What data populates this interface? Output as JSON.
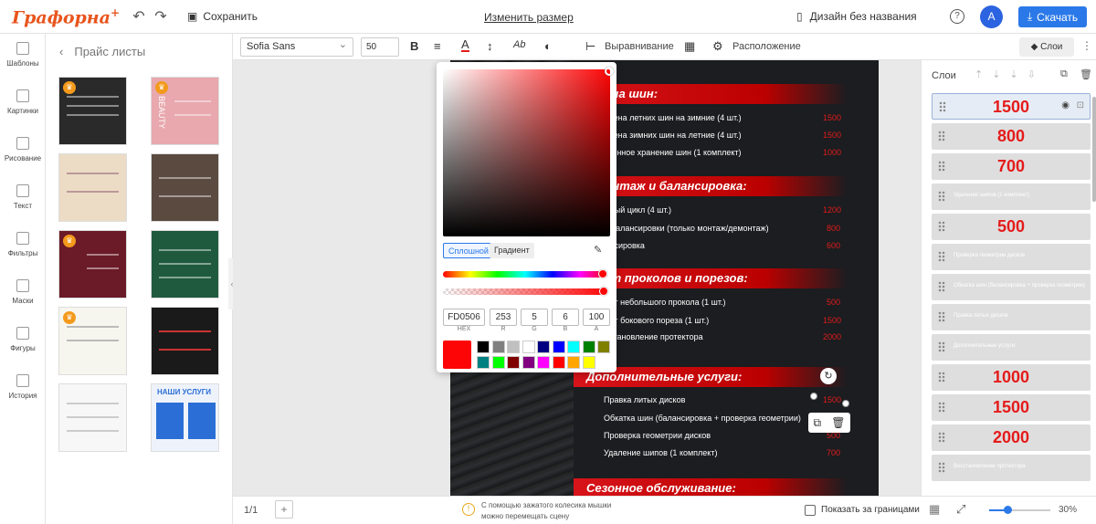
{
  "app": {
    "logo": "Графорна",
    "logo_plus": "+"
  },
  "topbar": {
    "save_label": "Сохранить",
    "resize_label": "Изменить размер",
    "doc_name": "Дизайн без названия",
    "help": "?",
    "avatar": "A",
    "download_label": "Скачать"
  },
  "leftnav": [
    {
      "label": "Шаблоны",
      "icon": "templates-icon"
    },
    {
      "label": "Картинки",
      "icon": "images-icon"
    },
    {
      "label": "Рисование",
      "icon": "draw-icon"
    },
    {
      "label": "Текст",
      "icon": "text-icon"
    },
    {
      "label": "Фильтры",
      "icon": "filters-icon"
    },
    {
      "label": "Маски",
      "icon": "masks-icon"
    },
    {
      "label": "Фигуры",
      "icon": "shapes-icon"
    },
    {
      "label": "История",
      "icon": "history-icon"
    }
  ],
  "panel": {
    "title": "Прайс листы",
    "thumb_text_1": "BEAUTY",
    "thumb_text_2": "НАШИ УСЛУГИ"
  },
  "toolbar": {
    "font": "Sofia Sans",
    "size": "50",
    "bold": "B",
    "align_label": "Выравнивание",
    "position_label": "Расположение",
    "layers_button": "Слои"
  },
  "color_picker": {
    "tab_solid": "Сплошной",
    "tab_gradient": "Градиент",
    "hex": "FD0506",
    "r": "253",
    "g": "5",
    "b": "6",
    "a": "100",
    "hex_label": "HEX",
    "r_label": "R",
    "g_label": "G",
    "b_label": "B",
    "a_label": "A",
    "current_color": "#fd0506",
    "hue": 0.995,
    "alpha": 1.0,
    "swatches": [
      "#000000",
      "#808080",
      "#c0c0c0",
      "#ffffff",
      "#000080",
      "#0000ff",
      "#00ffff",
      "#008000",
      "#808000",
      "#008080",
      "#00ff00",
      "#800000",
      "#800080",
      "#ff00ff",
      "#ff0000",
      "#ffa500",
      "#ffff00"
    ]
  },
  "poster": {
    "sections": [
      {
        "title": "Замена шин:",
        "shown": "...мена шин:",
        "rows": [
          [
            "Замена летних шин на зимние (4 шт.)",
            "1500"
          ],
          [
            "Замена зимних шин на летние (4 шт.)",
            "1500"
          ],
          [
            "Сезонное хранение шин (1 комплект)",
            "1000"
          ]
        ]
      },
      {
        "title": "...монтаж и балансировка:",
        "rows": [
          [
            "...лный цикл (4 шт.)",
            "1200"
          ],
          [
            "...з балансировки (только монтаж/демонтаж)",
            "800"
          ],
          [
            "...ансировка",
            "600"
          ]
        ]
      },
      {
        "title": "...онт проколов и порезов:",
        "rows": [
          [
            "...онт небольшого прокола (1 шт.)",
            "500"
          ],
          [
            "...онт бокового пореза (1 шт.)",
            "1500"
          ],
          [
            "...сстановление протектора",
            "2000"
          ]
        ]
      },
      {
        "title": "Дополнительные услуги:",
        "rows": [
          [
            "Правка литых дисков",
            "1500"
          ],
          [
            "Обкатка шин (балансировка + проверка геометрии)",
            "1000"
          ],
          [
            "Проверка геометрии дисков",
            "500"
          ],
          [
            "Удаление шипов (1 комплект)",
            "700"
          ]
        ]
      },
      {
        "title": "Сезонное обслуживание:",
        "rows": []
      }
    ]
  },
  "layers": {
    "title": "Слои",
    "items": [
      {
        "value": "1500",
        "type": "price"
      },
      {
        "value": "800",
        "type": "price"
      },
      {
        "value": "700",
        "type": "price"
      },
      {
        "value": "Удаление шипов (1 комплект)",
        "type": "text"
      },
      {
        "value": "500",
        "type": "price"
      },
      {
        "value": "Проверка геометрии дисков",
        "type": "text"
      },
      {
        "value": "Обкатка шин (балансировка + проверка геометрии)",
        "type": "text"
      },
      {
        "value": "Правка литых дисков",
        "type": "text"
      },
      {
        "value": "Дополнительные услуги:",
        "type": "text"
      },
      {
        "value": "1000",
        "type": "price"
      },
      {
        "value": "1500",
        "type": "price"
      },
      {
        "value": "2000",
        "type": "price"
      },
      {
        "value": "Восстановление протектора",
        "type": "text"
      }
    ]
  },
  "bottombar": {
    "page": "1/1",
    "hint": "С помощью зажатого колесика мышки можно перемещать сцену",
    "show_bounds": "Показать за границами",
    "zoom": "30%",
    "zoom_fraction": 0.3
  }
}
